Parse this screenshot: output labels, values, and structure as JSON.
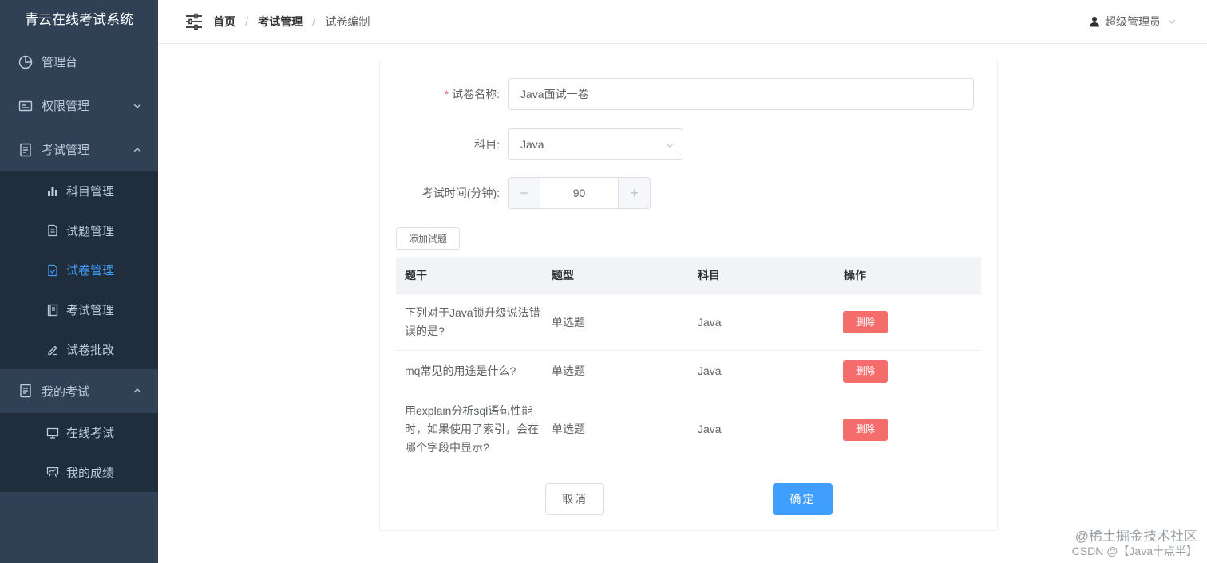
{
  "sidebar": {
    "title": "青云在线考试系统",
    "dashboard": "管理台",
    "permission": "权限管理",
    "exam_mgmt": "考试管理",
    "exam_sub": [
      "科目管理",
      "试题管理",
      "试卷管理",
      "考试管理",
      "试卷批改"
    ],
    "my_exam": "我的考试",
    "my_sub": [
      "在线考试",
      "我的成绩"
    ],
    "active_color": "#409eff"
  },
  "header": {
    "breadcrumb": [
      "首页",
      "考试管理",
      "试卷编制"
    ],
    "separator": "/",
    "user": "超级管理员"
  },
  "form": {
    "name_label": "试卷名称:",
    "name_value": "Java面试一卷",
    "subject_label": "科目:",
    "subject_value": "Java",
    "time_label": "考试时间(分钟):",
    "time_value": "90",
    "minus": "−",
    "plus": "+"
  },
  "add_button": "添加试题",
  "table": {
    "headers": [
      "题干",
      "题型",
      "科目",
      "操作"
    ],
    "rows": [
      {
        "stem": "下列对于Java锁升级说法错误的是?",
        "type": "单选题",
        "subject": "Java",
        "action": "删除"
      },
      {
        "stem": "mq常见的用途是什么?",
        "type": "单选题",
        "subject": "Java",
        "action": "删除"
      },
      {
        "stem": "用explain分析sql语句性能时，如果使用了索引，会在哪个字段中显示?",
        "type": "单选题",
        "subject": "Java",
        "action": "删除"
      }
    ]
  },
  "buttons": {
    "cancel": "取消",
    "confirm": "确定"
  },
  "watermark": {
    "line1": "@稀土掘金技术社区",
    "line2": "CSDN @【Java十点半】"
  },
  "colors": {
    "sidebar_bg": "#304156",
    "submenu_bg": "#1f2d3d",
    "primary": "#409eff",
    "danger": "#f56c6c"
  }
}
